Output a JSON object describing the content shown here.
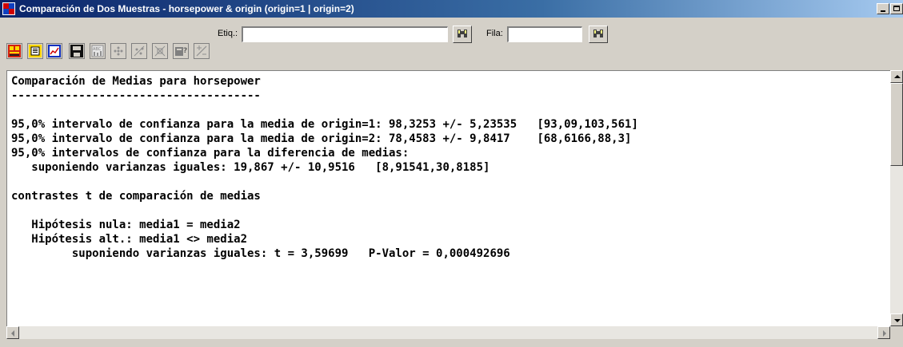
{
  "window": {
    "title": "Comparación de Dos Muestras - horsepower & origin (origin=1 | origin=2)"
  },
  "toolbar": {
    "buttons": [
      {
        "icon": "input-dialog-icon"
      },
      {
        "icon": "analysis-options-icon"
      },
      {
        "icon": "graphics-options-icon"
      },
      {
        "icon": "save-results-icon"
      },
      {
        "icon": "tabular-options-icon"
      },
      {
        "icon": "scatter-plot-icon"
      },
      {
        "icon": "exclude-points-icon"
      },
      {
        "icon": "pan-plot-icon"
      },
      {
        "icon": "format-plot-icon"
      },
      {
        "icon": "plot-line-icon"
      }
    ],
    "label_field_label": "Etiq.:",
    "label_field_value": "",
    "row_field_label": "Fila:",
    "row_field_value": ""
  },
  "output": {
    "lines": [
      "Comparación de Medias para horsepower",
      "-------------------------------------",
      "",
      "95,0% intervalo de confianza para la media de origin=1: 98,3253 +/- 5,23535   [93,09,103,561]",
      "95,0% intervalo de confianza para la media de origin=2: 78,4583 +/- 9,8417    [68,6166,88,3]",
      "95,0% intervalos de confianza para la diferencia de medias:",
      "   suponiendo varianzas iguales: 19,867 +/- 10,9516   [8,91541,30,8185]",
      "",
      "contrastes t de comparación de medias",
      "",
      "   Hipótesis nula: media1 = media2",
      "   Hipótesis alt.: media1 <> media2",
      "         suponiendo varianzas iguales: t = 3,59699   P-Valor = 0,000492696"
    ]
  },
  "colors": {
    "title_bar_start": "#0a246a",
    "title_bar_end": "#a6caf0",
    "chrome": "#d4d0c8"
  }
}
